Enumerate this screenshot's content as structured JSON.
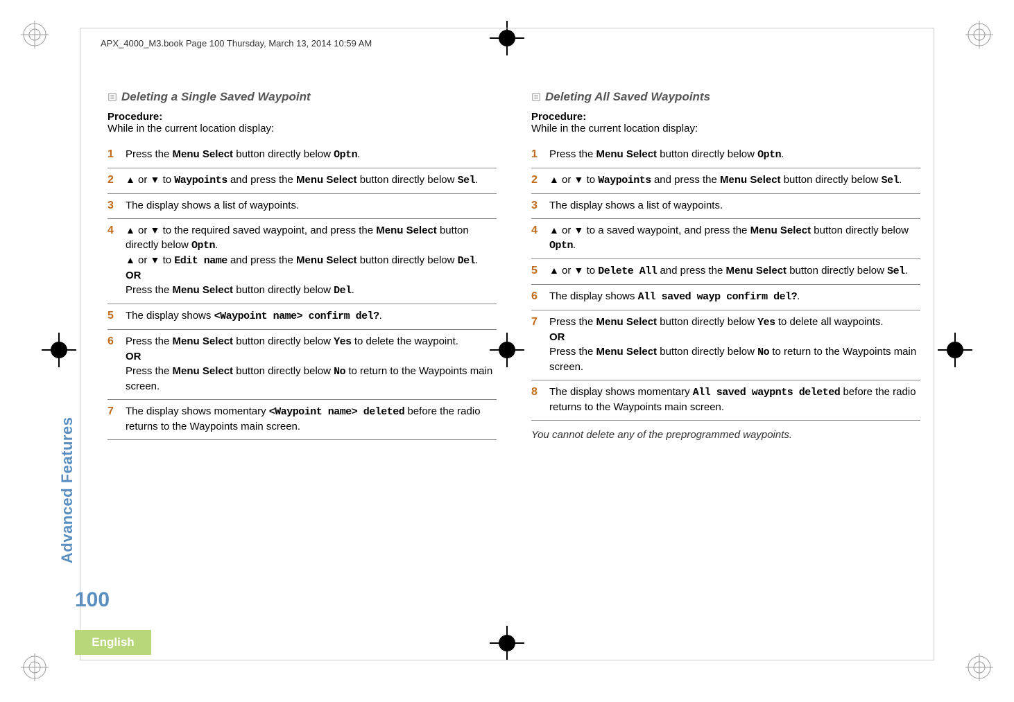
{
  "header": "APX_4000_M3.book  Page 100  Thursday, March 13, 2014  10:59 AM",
  "sideLabel": "Advanced Features",
  "pageNumber": "100",
  "languageTab": "English",
  "left": {
    "title": "Deleting a Single Saved Waypoint",
    "procHead": "Procedure:",
    "procSub": "While in the current location display:",
    "steps": [
      {
        "parts": [
          "Press the ",
          {
            "b": "Menu Select"
          },
          " button directly below ",
          {
            "ui": "Optn"
          },
          "."
        ]
      },
      {
        "parts": [
          {
            "arr": "▲"
          },
          " or ",
          {
            "arr": "▼"
          },
          " to ",
          {
            "ui": "Waypoints"
          },
          " and press the ",
          {
            "b": "Menu Select"
          },
          " button directly below ",
          {
            "ui": "Sel"
          },
          "."
        ]
      },
      {
        "parts": [
          "The display shows a list of waypoints."
        ]
      },
      {
        "parts": [
          {
            "arr": "▲"
          },
          " or ",
          {
            "arr": "▼"
          },
          " to the required saved waypoint, and press the ",
          {
            "b": "Menu Select"
          },
          " button directly below ",
          {
            "ui": "Optn"
          },
          ".",
          {
            "br": true
          },
          {
            "arr": "▲"
          },
          " or ",
          {
            "arr": "▼"
          },
          " to ",
          {
            "ui": "Edit name"
          },
          " and press the ",
          {
            "b": "Menu Select"
          },
          " button directly below ",
          {
            "ui": "Del"
          },
          ".",
          {
            "br": true
          },
          {
            "b": "OR"
          },
          {
            "br": true
          },
          "Press the ",
          {
            "b": "Menu Select"
          },
          " button directly below ",
          {
            "ui": "Del"
          },
          "."
        ]
      },
      {
        "parts": [
          "The display shows ",
          {
            "ui": "<Waypoint name> confirm del?"
          },
          "."
        ]
      },
      {
        "parts": [
          "Press the ",
          {
            "b": "Menu Select"
          },
          " button directly below ",
          {
            "ui": "Yes"
          },
          " to delete the waypoint.",
          {
            "br": true
          },
          {
            "b": "OR"
          },
          {
            "br": true
          },
          "Press the ",
          {
            "b": "Menu Select"
          },
          " button directly below ",
          {
            "ui": "No"
          },
          " to return to the Waypoints main screen."
        ]
      },
      {
        "parts": [
          "The display shows momentary ",
          {
            "ui": "<Waypoint name> deleted"
          },
          " before the radio returns to the Waypoints main screen."
        ]
      }
    ]
  },
  "right": {
    "title": "Deleting All Saved Waypoints",
    "procHead": "Procedure:",
    "procSub": "While in the current location display:",
    "steps": [
      {
        "parts": [
          "Press the ",
          {
            "b": "Menu Select"
          },
          " button directly below ",
          {
            "ui": "Optn"
          },
          "."
        ]
      },
      {
        "parts": [
          {
            "arr": "▲"
          },
          " or ",
          {
            "arr": "▼"
          },
          " to ",
          {
            "ui": "Waypoints"
          },
          " and press the ",
          {
            "b": "Menu Select"
          },
          " button directly below ",
          {
            "ui": "Sel"
          },
          "."
        ]
      },
      {
        "parts": [
          "The display shows a list of waypoints."
        ]
      },
      {
        "parts": [
          {
            "arr": "▲"
          },
          " or ",
          {
            "arr": "▼"
          },
          " to a saved waypoint, and press the ",
          {
            "b": "Menu Select"
          },
          " button directly below ",
          {
            "ui": "Optn"
          },
          "."
        ]
      },
      {
        "parts": [
          {
            "arr": "▲"
          },
          " or ",
          {
            "arr": "▼"
          },
          " to ",
          {
            "ui": "Delete All"
          },
          " and press the ",
          {
            "b": "Menu Select"
          },
          " button directly below ",
          {
            "ui": "Sel"
          },
          "."
        ]
      },
      {
        "parts": [
          "The display shows ",
          {
            "ui": "All saved wayp confirm del?"
          },
          "."
        ]
      },
      {
        "parts": [
          "Press the ",
          {
            "b": "Menu Select"
          },
          " button directly below ",
          {
            "ui": "Yes"
          },
          " to delete all waypoints.",
          {
            "br": true
          },
          {
            "b": "OR"
          },
          {
            "br": true
          },
          "Press the ",
          {
            "b": "Menu Select"
          },
          " button directly below ",
          {
            "ui": "No"
          },
          " to return to the Waypoints main screen."
        ]
      },
      {
        "parts": [
          "The display shows momentary ",
          {
            "ui": "All saved waypnts deleted"
          },
          " before the radio returns to the Waypoints main screen."
        ]
      }
    ],
    "note": "You cannot delete any of the preprogrammed waypoints."
  }
}
